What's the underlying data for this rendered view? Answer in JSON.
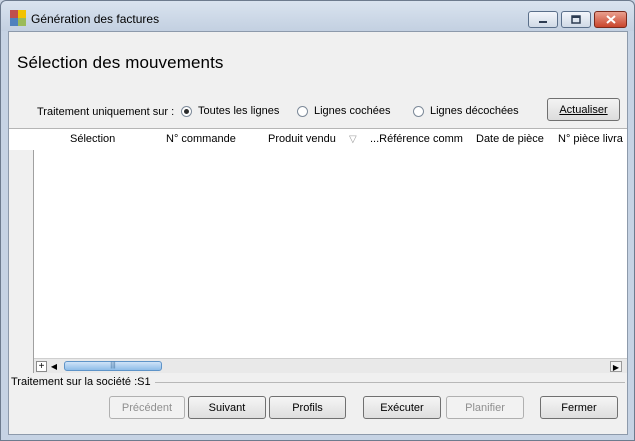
{
  "window": {
    "title": "Génération des factures",
    "min_icon": "minimize-icon",
    "max_icon": "maximize-icon",
    "close_icon": "close-icon"
  },
  "page": {
    "heading": "Sélection des mouvements"
  },
  "filter": {
    "label": "Traitement uniquement sur :",
    "options": [
      {
        "label": "Toutes les lignes",
        "checked": true
      },
      {
        "label": "Lignes cochées",
        "checked": false
      },
      {
        "label": "Lignes décochées",
        "checked": false
      }
    ],
    "refresh_label": "Actualiser"
  },
  "grid": {
    "columns": [
      "Sélection",
      "N° commande",
      "Produit vendu",
      "...Référence comm",
      "Date de pièce",
      "N° pièce livra"
    ],
    "rows": []
  },
  "status": {
    "company_text": "Traitement sur la société :S1"
  },
  "buttons": {
    "previous": "Précédent",
    "next": "Suivant",
    "profiles": "Profils",
    "execute": "Exécuter",
    "schedule": "Planifier",
    "close": "Fermer"
  },
  "colors": {
    "accent": "#3c7fb1",
    "close_button": "#c9452c"
  }
}
